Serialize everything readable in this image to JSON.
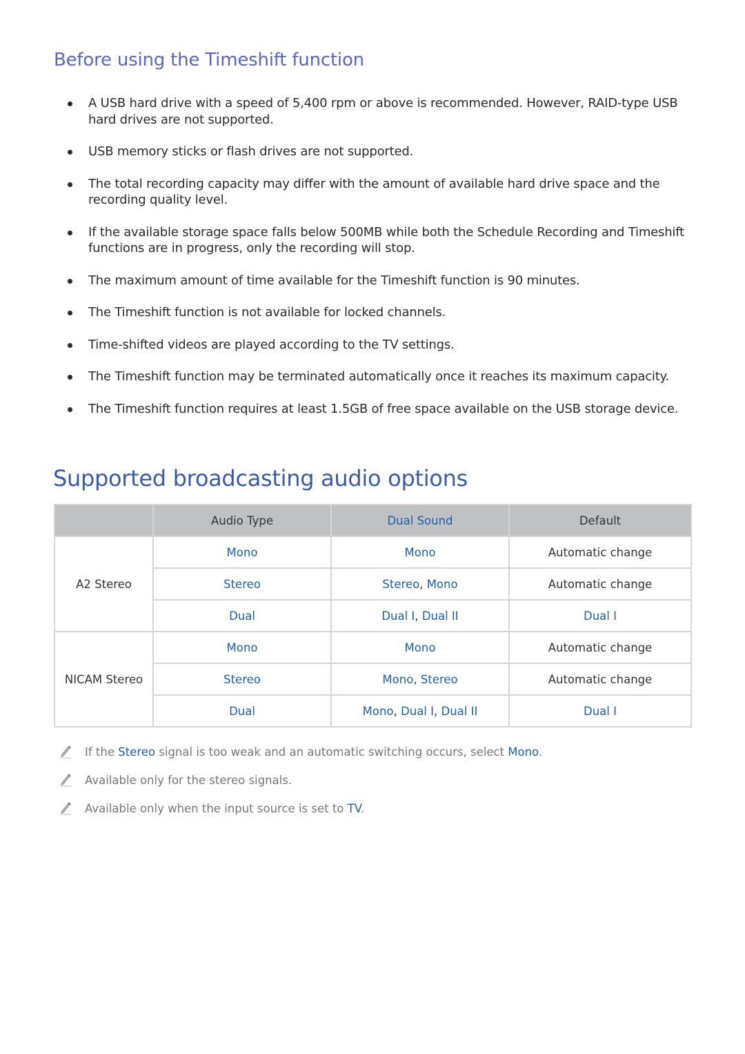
{
  "section1": {
    "heading": "Before using the Timeshift function",
    "bullets": [
      "A USB hard drive with a speed of 5,400 rpm or above is recommended. However, RAID-type USB hard drives are not supported.",
      "USB memory sticks or flash drives are not supported.",
      "The total recording capacity may differ with the amount of available hard drive space and the recording quality level.",
      "If the available storage space falls below 500MB while both the Schedule Recording and Timeshift functions are in progress, only the recording will stop.",
      "The maximum amount of time available for the Timeshift function is 90 minutes.",
      "The Timeshift function is not available for locked channels.",
      "Time-shifted videos are played according to the TV settings.",
      "The Timeshift function may be terminated automatically once it reaches its maximum capacity.",
      "The Timeshift function requires at least 1.5GB of free space available on the USB storage device."
    ]
  },
  "section2": {
    "heading": "Supported broadcasting audio options",
    "table": {
      "headers": [
        "",
        "Audio Type",
        "Dual Sound",
        "Default"
      ],
      "groups": [
        {
          "name": "A2 Stereo",
          "rows": [
            {
              "audio_type": "Mono",
              "dual_sound": [
                "Mono"
              ],
              "default": "Automatic change"
            },
            {
              "audio_type": "Stereo",
              "dual_sound": [
                "Stereo",
                "Mono"
              ],
              "default": "Automatic change"
            },
            {
              "audio_type": "Dual",
              "dual_sound": [
                "Dual I",
                "Dual II"
              ],
              "default": "Dual I"
            }
          ]
        },
        {
          "name": "NICAM Stereo",
          "rows": [
            {
              "audio_type": "Mono",
              "dual_sound": [
                "Mono"
              ],
              "default": "Automatic change"
            },
            {
              "audio_type": "Stereo",
              "dual_sound": [
                "Mono",
                "Stereo"
              ],
              "default": "Automatic change"
            },
            {
              "audio_type": "Dual",
              "dual_sound": [
                "Mono",
                "Dual I",
                "Dual II"
              ],
              "default": "Dual I"
            }
          ]
        }
      ]
    },
    "notes": [
      {
        "parts": [
          {
            "t": "If the ",
            "hl": false
          },
          {
            "t": "Stereo",
            "hl": true
          },
          {
            "t": " signal is too weak and an automatic switching occurs, select ",
            "hl": false
          },
          {
            "t": "Mono",
            "hl": true
          },
          {
            "t": ".",
            "hl": false
          }
        ]
      },
      {
        "parts": [
          {
            "t": "Available only for the stereo signals.",
            "hl": false
          }
        ]
      },
      {
        "parts": [
          {
            "t": "Available only when the input source is set to ",
            "hl": false
          },
          {
            "t": "TV",
            "hl": true
          },
          {
            "t": ".",
            "hl": false
          }
        ]
      }
    ]
  },
  "colors": {
    "subheading": "#5966c4",
    "heading": "#3a5ba8",
    "link": "#1d5fa8",
    "table_header_bg": "#c0c1c3"
  }
}
